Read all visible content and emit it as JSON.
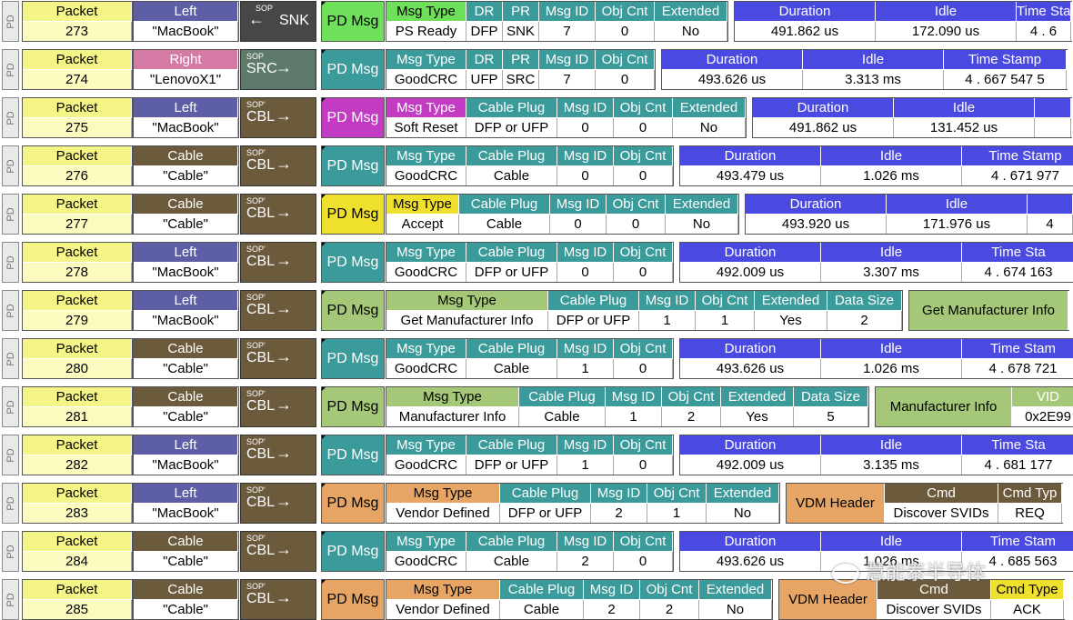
{
  "pd_label": "PD",
  "packet_header": "Packet",
  "rows": [
    {
      "packet": "273",
      "role": "Left",
      "role_color": "#5e5ea6",
      "name": "\"MacBook\"",
      "dir": {
        "sop": "SOP",
        "label": "SNK",
        "arrow": "←",
        "color": "#474747"
      },
      "msg": {
        "label": "PD Msg",
        "color": "#6ee05a",
        "text": "#000"
      },
      "fields": [
        {
          "h": "Msg Type",
          "v": "PS Ready",
          "w": 88,
          "hl": true
        },
        {
          "h": "DR",
          "v": "DFP",
          "w": 40
        },
        {
          "h": "PR",
          "v": "SNK",
          "w": 40
        },
        {
          "h": "Msg ID",
          "v": "7",
          "w": 62
        },
        {
          "h": "Obj Cnt",
          "v": "0",
          "w": 65
        },
        {
          "h": "Extended",
          "v": "No",
          "w": 80
        }
      ],
      "fcolor": "#3b9a9a",
      "hlcolor": "#6ee05a",
      "tail": [
        {
          "h": "Duration",
          "v": "491.862 us",
          "w": 155
        },
        {
          "h": "Idle",
          "v": "172.090 us",
          "w": 155
        },
        {
          "h": "Time Stamp",
          "v": "4 . 6",
          "w": 60
        }
      ],
      "tailcolor": "#4a4ae0"
    },
    {
      "packet": "274",
      "role": "Right",
      "role_color": "#d57aa4",
      "name": "\"LenovoX1\"",
      "dir": {
        "sop": "SOP",
        "label": "SRC",
        "arrow": "→",
        "color": "#5d7a6b"
      },
      "msg": {
        "label": "PD Msg",
        "color": "#3b9a9a",
        "text": "#fff"
      },
      "fields": [
        {
          "h": "Msg Type",
          "v": "GoodCRC",
          "w": 88
        },
        {
          "h": "DR",
          "v": "UFP",
          "w": 40
        },
        {
          "h": "PR",
          "v": "SRC",
          "w": 40
        },
        {
          "h": "Msg ID",
          "v": "7",
          "w": 62
        },
        {
          "h": "Obj Cnt",
          "v": "0",
          "w": 65
        }
      ],
      "fcolor": "#3b9a9a",
      "hlcolor": "#3b9a9a",
      "tail": [
        {
          "h": "Duration",
          "v": "493.626 us",
          "w": 155
        },
        {
          "h": "Idle",
          "v": "3.313 ms",
          "w": 155
        },
        {
          "h": "Time Stamp",
          "v": "4 . 667 547 5",
          "w": 135
        }
      ],
      "tailcolor": "#4a4ae0"
    },
    {
      "packet": "275",
      "role": "Left",
      "role_color": "#5e5ea6",
      "name": "\"MacBook\"",
      "dir": {
        "sop": "SOP'",
        "label": "CBL",
        "arrow": "→",
        "color": "#6b5a3c"
      },
      "msg": {
        "label": "PD Msg",
        "color": "#c23bc2",
        "text": "#fff"
      },
      "fields": [
        {
          "h": "Msg Type",
          "v": "Soft Reset",
          "w": 88,
          "hl": true
        },
        {
          "h": "Cable Plug",
          "v": "DFP or UFP",
          "w": 100
        },
        {
          "h": "Msg ID",
          "v": "0",
          "w": 62
        },
        {
          "h": "Obj Cnt",
          "v": "0",
          "w": 65
        },
        {
          "h": "Extended",
          "v": "No",
          "w": 80
        }
      ],
      "fcolor": "#3b9a9a",
      "hlcolor": "#c23bc2",
      "tail": [
        {
          "h": "Duration",
          "v": "491.862 us",
          "w": 155
        },
        {
          "h": "Idle",
          "v": "131.452 us",
          "w": 155
        },
        {
          "h": "",
          "v": "",
          "w": 40
        }
      ],
      "tailcolor": "#4a4ae0"
    },
    {
      "packet": "276",
      "role": "Cable",
      "role_color": "#6b5a3c",
      "name": "\"Cable\"",
      "dir": {
        "sop": "SOP'",
        "label": "CBL",
        "arrow": "→",
        "color": "#6b5a3c"
      },
      "msg": {
        "label": "PD Msg",
        "color": "#3b9a9a",
        "text": "#fff"
      },
      "fields": [
        {
          "h": "Msg Type",
          "v": "GoodCRC",
          "w": 88
        },
        {
          "h": "Cable Plug",
          "v": "Cable",
          "w": 100
        },
        {
          "h": "Msg ID",
          "v": "0",
          "w": 62
        },
        {
          "h": "Obj Cnt",
          "v": "0",
          "w": 65
        }
      ],
      "fcolor": "#3b9a9a",
      "hlcolor": "#3b9a9a",
      "tail": [
        {
          "h": "Duration",
          "v": "493.479 us",
          "w": 155
        },
        {
          "h": "Idle",
          "v": "1.026 ms",
          "w": 155
        },
        {
          "h": "Time Stamp",
          "v": "4 . 671 977",
          "w": 140
        }
      ],
      "tailcolor": "#4a4ae0"
    },
    {
      "packet": "277",
      "role": "Cable",
      "role_color": "#6b5a3c",
      "name": "\"Cable\"",
      "dir": {
        "sop": "SOP'",
        "label": "CBL",
        "arrow": "→",
        "color": "#6b5a3c"
      },
      "msg": {
        "label": "PD Msg",
        "color": "#f0e02e",
        "text": "#000"
      },
      "fields": [
        {
          "h": "Msg Type",
          "v": "Accept",
          "w": 80,
          "hl": true
        },
        {
          "h": "Cable Plug",
          "v": "Cable",
          "w": 100
        },
        {
          "h": "Msg ID",
          "v": "0",
          "w": 62
        },
        {
          "h": "Obj Cnt",
          "v": "0",
          "w": 65
        },
        {
          "h": "Extended",
          "v": "No",
          "w": 80
        }
      ],
      "fcolor": "#3b9a9a",
      "hlcolor": "#f0e02e",
      "tail": [
        {
          "h": "Duration",
          "v": "493.920 us",
          "w": 155
        },
        {
          "h": "Idle",
          "v": "171.976 us",
          "w": 155
        },
        {
          "h": "",
          "v": "4",
          "w": 50
        }
      ],
      "tailcolor": "#4a4ae0"
    },
    {
      "packet": "278",
      "role": "Left",
      "role_color": "#5e5ea6",
      "name": "\"MacBook\"",
      "dir": {
        "sop": "SOP'",
        "label": "CBL",
        "arrow": "→",
        "color": "#6b5a3c"
      },
      "msg": {
        "label": "PD Msg",
        "color": "#3b9a9a",
        "text": "#fff"
      },
      "fields": [
        {
          "h": "Msg Type",
          "v": "GoodCRC",
          "w": 88
        },
        {
          "h": "Cable Plug",
          "v": "DFP or UFP",
          "w": 100
        },
        {
          "h": "Msg ID",
          "v": "0",
          "w": 62
        },
        {
          "h": "Obj Cnt",
          "v": "0",
          "w": 65
        }
      ],
      "fcolor": "#3b9a9a",
      "hlcolor": "#3b9a9a",
      "tail": [
        {
          "h": "Duration",
          "v": "492.009 us",
          "w": 155
        },
        {
          "h": "Idle",
          "v": "3.307 ms",
          "w": 155
        },
        {
          "h": "Time Sta",
          "v": "4 . 674 163",
          "w": 125
        }
      ],
      "tailcolor": "#4a4ae0"
    },
    {
      "packet": "279",
      "role": "Left",
      "role_color": "#5e5ea6",
      "name": "\"MacBook\"",
      "dir": {
        "sop": "SOP'",
        "label": "CBL",
        "arrow": "→",
        "color": "#6b5a3c"
      },
      "msg": {
        "label": "PD Msg",
        "color": "#a5c878",
        "text": "#000"
      },
      "fields": [
        {
          "h": "Msg Type",
          "v": "Get Manufacturer Info",
          "w": 178,
          "hl": true
        },
        {
          "h": "Cable Plug",
          "v": "DFP or UFP",
          "w": 100
        },
        {
          "h": "Msg ID",
          "v": "1",
          "w": 62
        },
        {
          "h": "Obj Cnt",
          "v": "1",
          "w": 65
        },
        {
          "h": "Extended",
          "v": "Yes",
          "w": 80
        },
        {
          "h": "Data Size",
          "v": "2",
          "w": 82
        }
      ],
      "fcolor": "#3b9a9a",
      "hlcolor": "#a5c878",
      "tail": [
        {
          "h": "Get Manufacturer Info",
          "v": "",
          "w": 175,
          "span": true
        }
      ],
      "tailcolor": "#a5c878"
    },
    {
      "packet": "280",
      "role": "Cable",
      "role_color": "#6b5a3c",
      "name": "\"Cable\"",
      "dir": {
        "sop": "SOP'",
        "label": "CBL",
        "arrow": "→",
        "color": "#6b5a3c"
      },
      "msg": {
        "label": "PD Msg",
        "color": "#3b9a9a",
        "text": "#fff"
      },
      "fields": [
        {
          "h": "Msg Type",
          "v": "GoodCRC",
          "w": 88
        },
        {
          "h": "Cable Plug",
          "v": "Cable",
          "w": 100
        },
        {
          "h": "Msg ID",
          "v": "1",
          "w": 62
        },
        {
          "h": "Obj Cnt",
          "v": "0",
          "w": 65
        }
      ],
      "fcolor": "#3b9a9a",
      "hlcolor": "#3b9a9a",
      "tail": [
        {
          "h": "Duration",
          "v": "493.626 us",
          "w": 155
        },
        {
          "h": "Idle",
          "v": "1.026 ms",
          "w": 155
        },
        {
          "h": "Time Stam",
          "v": "4 . 678 721",
          "w": 135
        }
      ],
      "tailcolor": "#4a4ae0"
    },
    {
      "packet": "281",
      "role": "Cable",
      "role_color": "#6b5a3c",
      "name": "\"Cable\"",
      "dir": {
        "sop": "SOP'",
        "label": "CBL",
        "arrow": "→",
        "color": "#6b5a3c"
      },
      "msg": {
        "label": "PD Msg",
        "color": "#a5c878",
        "text": "#000"
      },
      "fields": [
        {
          "h": "Msg Type",
          "v": "Manufacturer Info",
          "w": 146,
          "hl": true
        },
        {
          "h": "Cable Plug",
          "v": "Cable",
          "w": 95
        },
        {
          "h": "Msg ID",
          "v": "1",
          "w": 62
        },
        {
          "h": "Obj Cnt",
          "v": "2",
          "w": 65
        },
        {
          "h": "Extended",
          "v": "Yes",
          "w": 80
        },
        {
          "h": "Data Size",
          "v": "5",
          "w": 82
        }
      ],
      "fcolor": "#3b9a9a",
      "hlcolor": "#a5c878",
      "tail": [
        {
          "h": "Manufacturer Info",
          "v": "",
          "w": 150,
          "span": true
        },
        {
          "h": "VID",
          "v": "0x2E99",
          "w": 80
        }
      ],
      "tailcolor": "#a5c878"
    },
    {
      "packet": "282",
      "role": "Left",
      "role_color": "#5e5ea6",
      "name": "\"MacBook\"",
      "dir": {
        "sop": "SOP'",
        "label": "CBL",
        "arrow": "→",
        "color": "#6b5a3c"
      },
      "msg": {
        "label": "PD Msg",
        "color": "#3b9a9a",
        "text": "#fff"
      },
      "fields": [
        {
          "h": "Msg Type",
          "v": "GoodCRC",
          "w": 88
        },
        {
          "h": "Cable Plug",
          "v": "DFP or UFP",
          "w": 100
        },
        {
          "h": "Msg ID",
          "v": "1",
          "w": 62
        },
        {
          "h": "Obj Cnt",
          "v": "0",
          "w": 65
        }
      ],
      "fcolor": "#3b9a9a",
      "hlcolor": "#3b9a9a",
      "tail": [
        {
          "h": "Duration",
          "v": "492.009 us",
          "w": 155
        },
        {
          "h": "Idle",
          "v": "3.135 ms",
          "w": 155
        },
        {
          "h": "Time Sta",
          "v": "4 . 681 177",
          "w": 125
        }
      ],
      "tailcolor": "#4a4ae0"
    },
    {
      "packet": "283",
      "role": "Left",
      "role_color": "#5e5ea6",
      "name": "\"MacBook\"",
      "dir": {
        "sop": "SOP'",
        "label": "CBL",
        "arrow": "→",
        "color": "#6b5a3c"
      },
      "msg": {
        "label": "PD Msg",
        "color": "#e6a565",
        "text": "#000"
      },
      "fields": [
        {
          "h": "Msg Type",
          "v": "Vendor Defined",
          "w": 125,
          "hl": true
        },
        {
          "h": "Cable Plug",
          "v": "DFP or UFP",
          "w": 100
        },
        {
          "h": "Msg ID",
          "v": "2",
          "w": 62
        },
        {
          "h": "Obj Cnt",
          "v": "1",
          "w": 65
        },
        {
          "h": "Extended",
          "v": "No",
          "w": 80
        }
      ],
      "fcolor": "#3b9a9a",
      "hlcolor": "#e6a565",
      "tail": [
        {
          "h": "VDM Header",
          "v": "",
          "w": 108,
          "span": true
        },
        {
          "h": "Cmd",
          "v": "Discover SVIDs",
          "w": 125
        },
        {
          "h": "Cmd Typ",
          "v": "REQ",
          "w": 70
        }
      ],
      "tailcolor": "#e6a565",
      "tailcolor2": "#6b5a3c"
    },
    {
      "packet": "284",
      "role": "Cable",
      "role_color": "#6b5a3c",
      "name": "\"Cable\"",
      "dir": {
        "sop": "SOP'",
        "label": "CBL",
        "arrow": "→",
        "color": "#6b5a3c"
      },
      "msg": {
        "label": "PD Msg",
        "color": "#3b9a9a",
        "text": "#fff"
      },
      "fields": [
        {
          "h": "Msg Type",
          "v": "GoodCRC",
          "w": 88
        },
        {
          "h": "Cable Plug",
          "v": "Cable",
          "w": 100
        },
        {
          "h": "Msg ID",
          "v": "2",
          "w": 62
        },
        {
          "h": "Obj Cnt",
          "v": "0",
          "w": 65
        }
      ],
      "fcolor": "#3b9a9a",
      "hlcolor": "#3b9a9a",
      "tail": [
        {
          "h": "Duration",
          "v": "493.626 us",
          "w": 155
        },
        {
          "h": "Idle",
          "v": "1.026 ms",
          "w": 155
        },
        {
          "h": "Time Stam",
          "v": "4 . 685 563",
          "w": 135
        }
      ],
      "tailcolor": "#4a4ae0"
    },
    {
      "packet": "285",
      "role": "Cable",
      "role_color": "#6b5a3c",
      "name": "\"Cable\"",
      "dir": {
        "sop": "SOP'",
        "label": "CBL",
        "arrow": "→",
        "color": "#6b5a3c"
      },
      "msg": {
        "label": "PD Msg",
        "color": "#e6a565",
        "text": "#000"
      },
      "fields": [
        {
          "h": "Msg Type",
          "v": "Vendor Defined",
          "w": 125,
          "hl": true
        },
        {
          "h": "Cable Plug",
          "v": "Cable",
          "w": 92
        },
        {
          "h": "Msg ID",
          "v": "2",
          "w": 62
        },
        {
          "h": "Obj Cnt",
          "v": "2",
          "w": 65
        },
        {
          "h": "Extended",
          "v": "No",
          "w": 80
        }
      ],
      "fcolor": "#3b9a9a",
      "hlcolor": "#e6a565",
      "tail": [
        {
          "h": "VDM Header",
          "v": "",
          "w": 108,
          "span": true
        },
        {
          "h": "Cmd",
          "v": "Discover SVIDs",
          "w": 125
        },
        {
          "h": "Cmd Type",
          "v": "ACK",
          "w": 80
        }
      ],
      "tailcolor": "#e6a565",
      "tailcolor2": "#6b5a3c",
      "lastyellow": true
    }
  ],
  "watermark": "慧能泰半导体"
}
